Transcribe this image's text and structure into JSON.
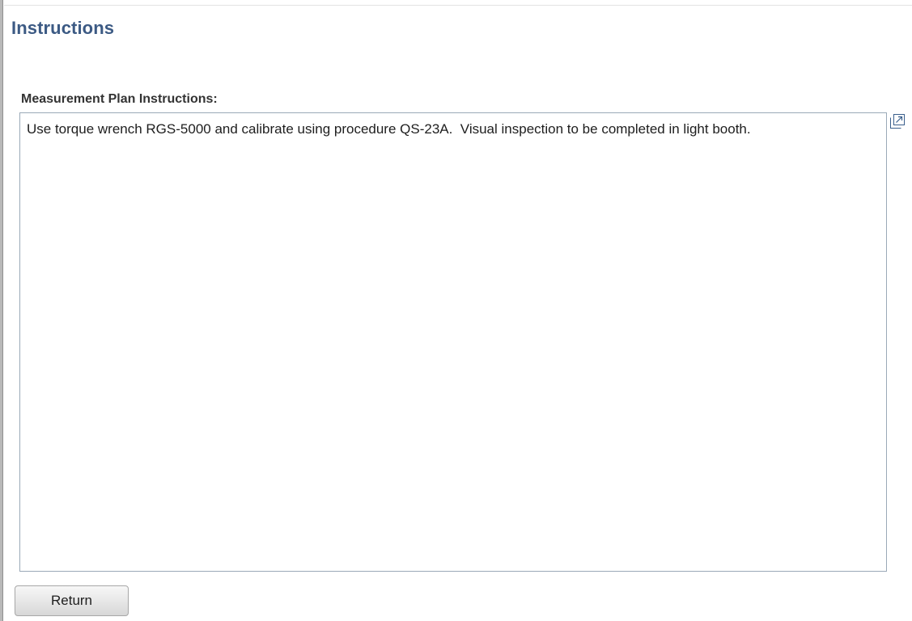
{
  "page": {
    "title": "Instructions"
  },
  "measurement_plan": {
    "label": "Measurement Plan Instructions:",
    "text": "Use torque wrench RGS-5000 and calibrate using procedure QS-23A.  Visual inspection to be completed in light booth.",
    "expand_icon": "expand-icon"
  },
  "actions": {
    "return_label": "Return"
  },
  "colors": {
    "title": "#3c5a84",
    "field_border": "#9aa9b8",
    "icon_blue": "#3a5f8c"
  }
}
